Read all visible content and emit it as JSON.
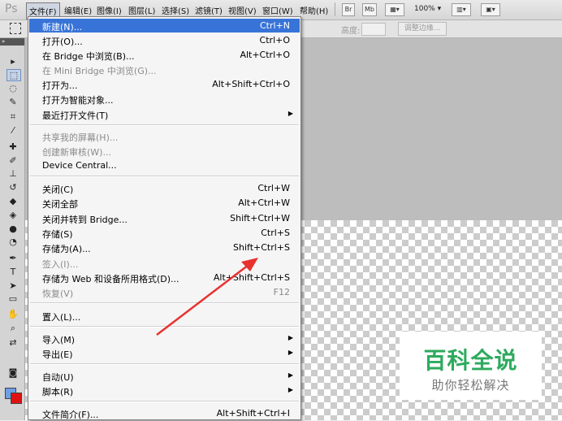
{
  "app": {
    "logo": "Ps"
  },
  "menubar": {
    "items": [
      "文件(F)",
      "编辑(E)",
      "图像(I)",
      "图层(L)",
      "选择(S)",
      "滤镜(T)",
      "视图(V)",
      "窗口(W)",
      "帮助(H)"
    ],
    "br_button": "Br",
    "mb_button": "Mb",
    "zoom": "100%"
  },
  "options_bar": {
    "feather_label": "高度:",
    "refine_button": "调整边缘..."
  },
  "menu": {
    "items": [
      {
        "label": "新建(N)...",
        "shortcut": "Ctrl+N"
      },
      {
        "label": "打开(O)...",
        "shortcut": "Ctrl+O"
      },
      {
        "label": "在 Bridge 中浏览(B)...",
        "shortcut": "Alt+Ctrl+O"
      },
      {
        "label": "在 Mini Bridge 中浏览(G)...",
        "shortcut": ""
      },
      {
        "label": "打开为...",
        "shortcut": "Alt+Shift+Ctrl+O"
      },
      {
        "label": "打开为智能对象...",
        "shortcut": ""
      },
      {
        "label": "最近打开文件(T)",
        "shortcut": ""
      },
      {
        "label": "共享我的屏幕(H)...",
        "shortcut": ""
      },
      {
        "label": "创建新审核(W)...",
        "shortcut": ""
      },
      {
        "label": "Device Central...",
        "shortcut": ""
      },
      {
        "label": "关闭(C)",
        "shortcut": "Ctrl+W"
      },
      {
        "label": "关闭全部",
        "shortcut": "Alt+Ctrl+W"
      },
      {
        "label": "关闭并转到 Bridge...",
        "shortcut": "Shift+Ctrl+W"
      },
      {
        "label": "存储(S)",
        "shortcut": "Ctrl+S"
      },
      {
        "label": "存储为(A)...",
        "shortcut": "Shift+Ctrl+S"
      },
      {
        "label": "签入(I)...",
        "shortcut": ""
      },
      {
        "label": "存储为 Web 和设备所用格式(D)...",
        "shortcut": "Alt+Shift+Ctrl+S"
      },
      {
        "label": "恢复(V)",
        "shortcut": "F12"
      },
      {
        "label": "置入(L)...",
        "shortcut": ""
      },
      {
        "label": "导入(M)",
        "shortcut": ""
      },
      {
        "label": "导出(E)",
        "shortcut": ""
      },
      {
        "label": "自动(U)",
        "shortcut": ""
      },
      {
        "label": "脚本(R)",
        "shortcut": ""
      },
      {
        "label": "文件简介(F)...",
        "shortcut": "Alt+Shift+Ctrl+I"
      }
    ]
  },
  "watermark": {
    "title": "百科全说",
    "subtitle": "助你轻松解决"
  },
  "colors": {
    "highlight": "#3874d8",
    "annotation_arrow": "#e8322f",
    "watermark_green": "#2eaa5e"
  }
}
